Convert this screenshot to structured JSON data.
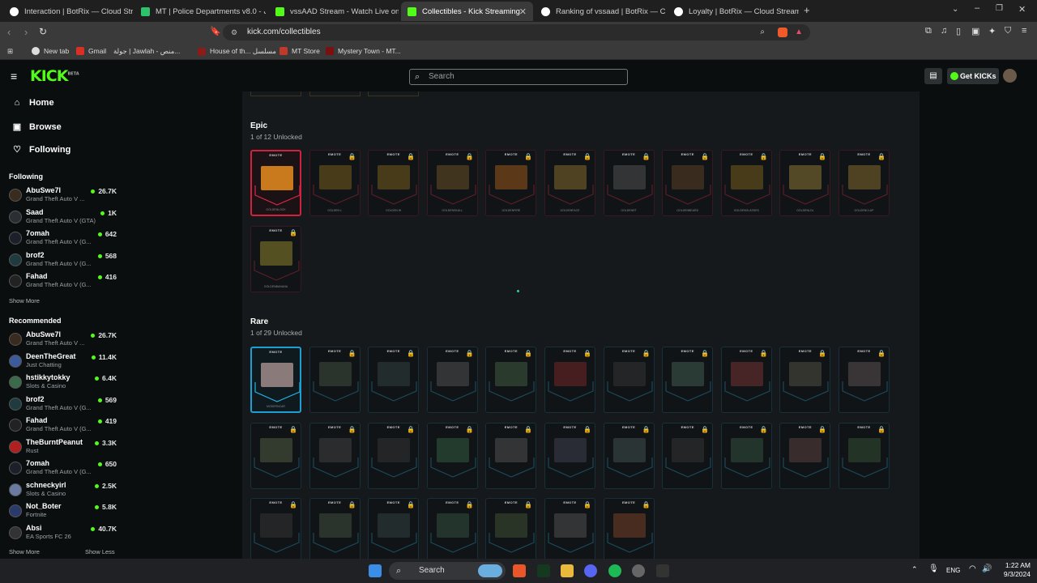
{
  "tabs": [
    {
      "title": "Interaction | BotRix — Cloud Stre...",
      "color": "#ffffff"
    },
    {
      "title": "MT | Police Departments v8.0 - بيانات",
      "color": "#2ec26b"
    },
    {
      "title": "vssAAD Stream - Watch Live on Kick",
      "color": "#53fc18"
    },
    {
      "title": "Collectibles - Kick Streaming",
      "color": "#53fc18"
    },
    {
      "title": "Ranking of vssaad | BotRix — Cloud ...",
      "color": "#ffffff"
    },
    {
      "title": "Loyalty | BotRix — Cloud Streaming ...",
      "color": "#ffffff"
    }
  ],
  "browser": {
    "url": "kick.com/collectibles",
    "bookmarks": [
      "New tab",
      "Gmail",
      "جولة | Jawlah - منص...",
      "House of th... مسلسل",
      "MT Store",
      "Mystery Town - MT..."
    ]
  },
  "kick": {
    "logo": "KICK",
    "beta": "BETA",
    "search_placeholder": "Search",
    "get_kicks": "Get KICKs"
  },
  "sidebar": {
    "nav": [
      {
        "label": "Home",
        "icon": "home-icon"
      },
      {
        "label": "Browse",
        "icon": "browse-icon"
      },
      {
        "label": "Following",
        "icon": "heart-icon"
      }
    ],
    "following_title": "Following",
    "following": [
      {
        "name": "AbuSwe7l",
        "game": "Grand Theft Auto V ...",
        "viewers": "26.7K",
        "color": "#3a2b1f"
      },
      {
        "name": "Saad",
        "game": "Grand Theft Auto V (GTA)",
        "viewers": "1K",
        "color": "#2a2f33"
      },
      {
        "name": "7omah",
        "game": "Grand Theft Auto V (G...",
        "viewers": "642",
        "color": "#1d1f2a"
      },
      {
        "name": "brof2",
        "game": "Grand Theft Auto V (G...",
        "viewers": "568",
        "color": "#1f3b3f"
      },
      {
        "name": "Fahad",
        "game": "Grand Theft Auto V (G...",
        "viewers": "416",
        "color": "#222"
      }
    ],
    "show_more": "Show More",
    "recommended_title": "Recommended",
    "recommended": [
      {
        "name": "AbuSwe7l",
        "game": "Grand Theft Auto V ...",
        "viewers": "26.7K",
        "color": "#3a2b1f"
      },
      {
        "name": "DeenTheGreat",
        "game": "Just Chatting",
        "viewers": "11.4K",
        "color": "#3d5a9a"
      },
      {
        "name": "hstikkytokky",
        "game": "Slots & Casino",
        "viewers": "6.4K",
        "color": "#3a6a4a"
      },
      {
        "name": "brof2",
        "game": "Grand Theft Auto V (G...",
        "viewers": "569",
        "color": "#1f3b3f"
      },
      {
        "name": "Fahad",
        "game": "Grand Theft Auto V (G...",
        "viewers": "419",
        "color": "#222"
      },
      {
        "name": "TheBurntPeanut",
        "game": "Rust",
        "viewers": "3.3K",
        "color": "#b02020"
      },
      {
        "name": "7omah",
        "game": "Grand Theft Auto V (G...",
        "viewers": "650",
        "color": "#1d1f2a"
      },
      {
        "name": "schneckyirl",
        "game": "Slots & Casino",
        "viewers": "2.5K",
        "color": "#6a7aa0"
      },
      {
        "name": "Not_Boter",
        "game": "Fortnite",
        "viewers": "5.8K",
        "color": "#2a3a6a"
      },
      {
        "name": "Absi",
        "game": "EA Sports FC 26",
        "viewers": "40.7K",
        "color": "#333"
      }
    ],
    "show_more2": "Show More",
    "show_less": "Show Less"
  },
  "epic": {
    "title": "Epic",
    "subtitle": "1 of 12 Unlocked",
    "emote_label": "EMOTE",
    "cards": [
      {
        "name": "GOLDENLOCK",
        "art": "#c87a1c",
        "unlocked": true
      },
      {
        "name": "GOLDEN L",
        "art": "#8a6a1c",
        "unlocked": false
      },
      {
        "name": "GOLDEN W",
        "art": "#8a6a1c",
        "unlocked": false
      },
      {
        "name": "GOLDENSKULL",
        "art": "#7a5a2a",
        "unlocked": false
      },
      {
        "name": "GOLDENFIRE",
        "art": "#b5661a",
        "unlocked": false
      },
      {
        "name": "GOLDENFACE",
        "art": "#9a7a30",
        "unlocked": false
      },
      {
        "name": "GOLDENRT",
        "art": "#5a5a5a",
        "unlocked": false
      },
      {
        "name": "GOLDENBEARD",
        "art": "#6a4a2a",
        "unlocked": false
      },
      {
        "name": "GOLDENGLASSES",
        "art": "#8a6a1c",
        "unlocked": false
      },
      {
        "name": "GOLDENLOL",
        "art": "#a58a3a",
        "unlocked": false
      },
      {
        "name": "GOLDENCLAP",
        "art": "#9a7a30",
        "unlocked": false
      },
      {
        "name": "GOLDENBANANA",
        "art": "#a89a30",
        "unlocked": false
      }
    ]
  },
  "rare": {
    "title": "Rare",
    "subtitle": "1 of 29 Unlocked",
    "emote_label": "EMOTE",
    "cards": [
      {
        "name": "MODERNCAR",
        "art": "#8a7a7a",
        "unlocked": true
      },
      {
        "name": "",
        "art": "#4a5a4a",
        "unlocked": false
      },
      {
        "name": "",
        "art": "#3a4a4a",
        "unlocked": false
      },
      {
        "name": "",
        "art": "#5a5a5a",
        "unlocked": false
      },
      {
        "name": "",
        "art": "#4a6a4a",
        "unlocked": false
      },
      {
        "name": "",
        "art": "#8a2a2a",
        "unlocked": false
      },
      {
        "name": "",
        "art": "#3a3a3a",
        "unlocked": false
      },
      {
        "name": "",
        "art": "#4a6a5a",
        "unlocked": false
      },
      {
        "name": "",
        "art": "#8a3a3a",
        "unlocked": false
      },
      {
        "name": "",
        "art": "#5a5a4a",
        "unlocked": false
      },
      {
        "name": "",
        "art": "#6a5a5a",
        "unlocked": false
      },
      {
        "name": "",
        "art": "#5a6a4a",
        "unlocked": false
      },
      {
        "name": "",
        "art": "#4a4a4a",
        "unlocked": false
      },
      {
        "name": "",
        "art": "#3a3a3a",
        "unlocked": false
      },
      {
        "name": "",
        "art": "#3a6a4a",
        "unlocked": false
      },
      {
        "name": "",
        "art": "#5a5a5a",
        "unlocked": false
      },
      {
        "name": "",
        "art": "#4a4a5a",
        "unlocked": false
      },
      {
        "name": "",
        "art": "#4a5a5a",
        "unlocked": false
      },
      {
        "name": "",
        "art": "#3a3a3a",
        "unlocked": false
      },
      {
        "name": "",
        "art": "#3a5a4a",
        "unlocked": false
      },
      {
        "name": "",
        "art": "#6a4a4a",
        "unlocked": false
      },
      {
        "name": "",
        "art": "#3a5a3a",
        "unlocked": false
      },
      {
        "name": "",
        "art": "#3a3a3a",
        "unlocked": false
      },
      {
        "name": "",
        "art": "#4a5a4a",
        "unlocked": false
      },
      {
        "name": "",
        "art": "#3a4a4a",
        "unlocked": false
      },
      {
        "name": "",
        "art": "#3a5a4a",
        "unlocked": false
      },
      {
        "name": "",
        "art": "#4a5a3a",
        "unlocked": false
      },
      {
        "name": "",
        "art": "#5a5a5a",
        "unlocked": false
      },
      {
        "name": "",
        "art": "#8a4a2a",
        "unlocked": false
      }
    ]
  },
  "taskbar": {
    "search": "Search",
    "lang": "ENG",
    "time": "1:22 AM",
    "date": "9/3/2024"
  }
}
